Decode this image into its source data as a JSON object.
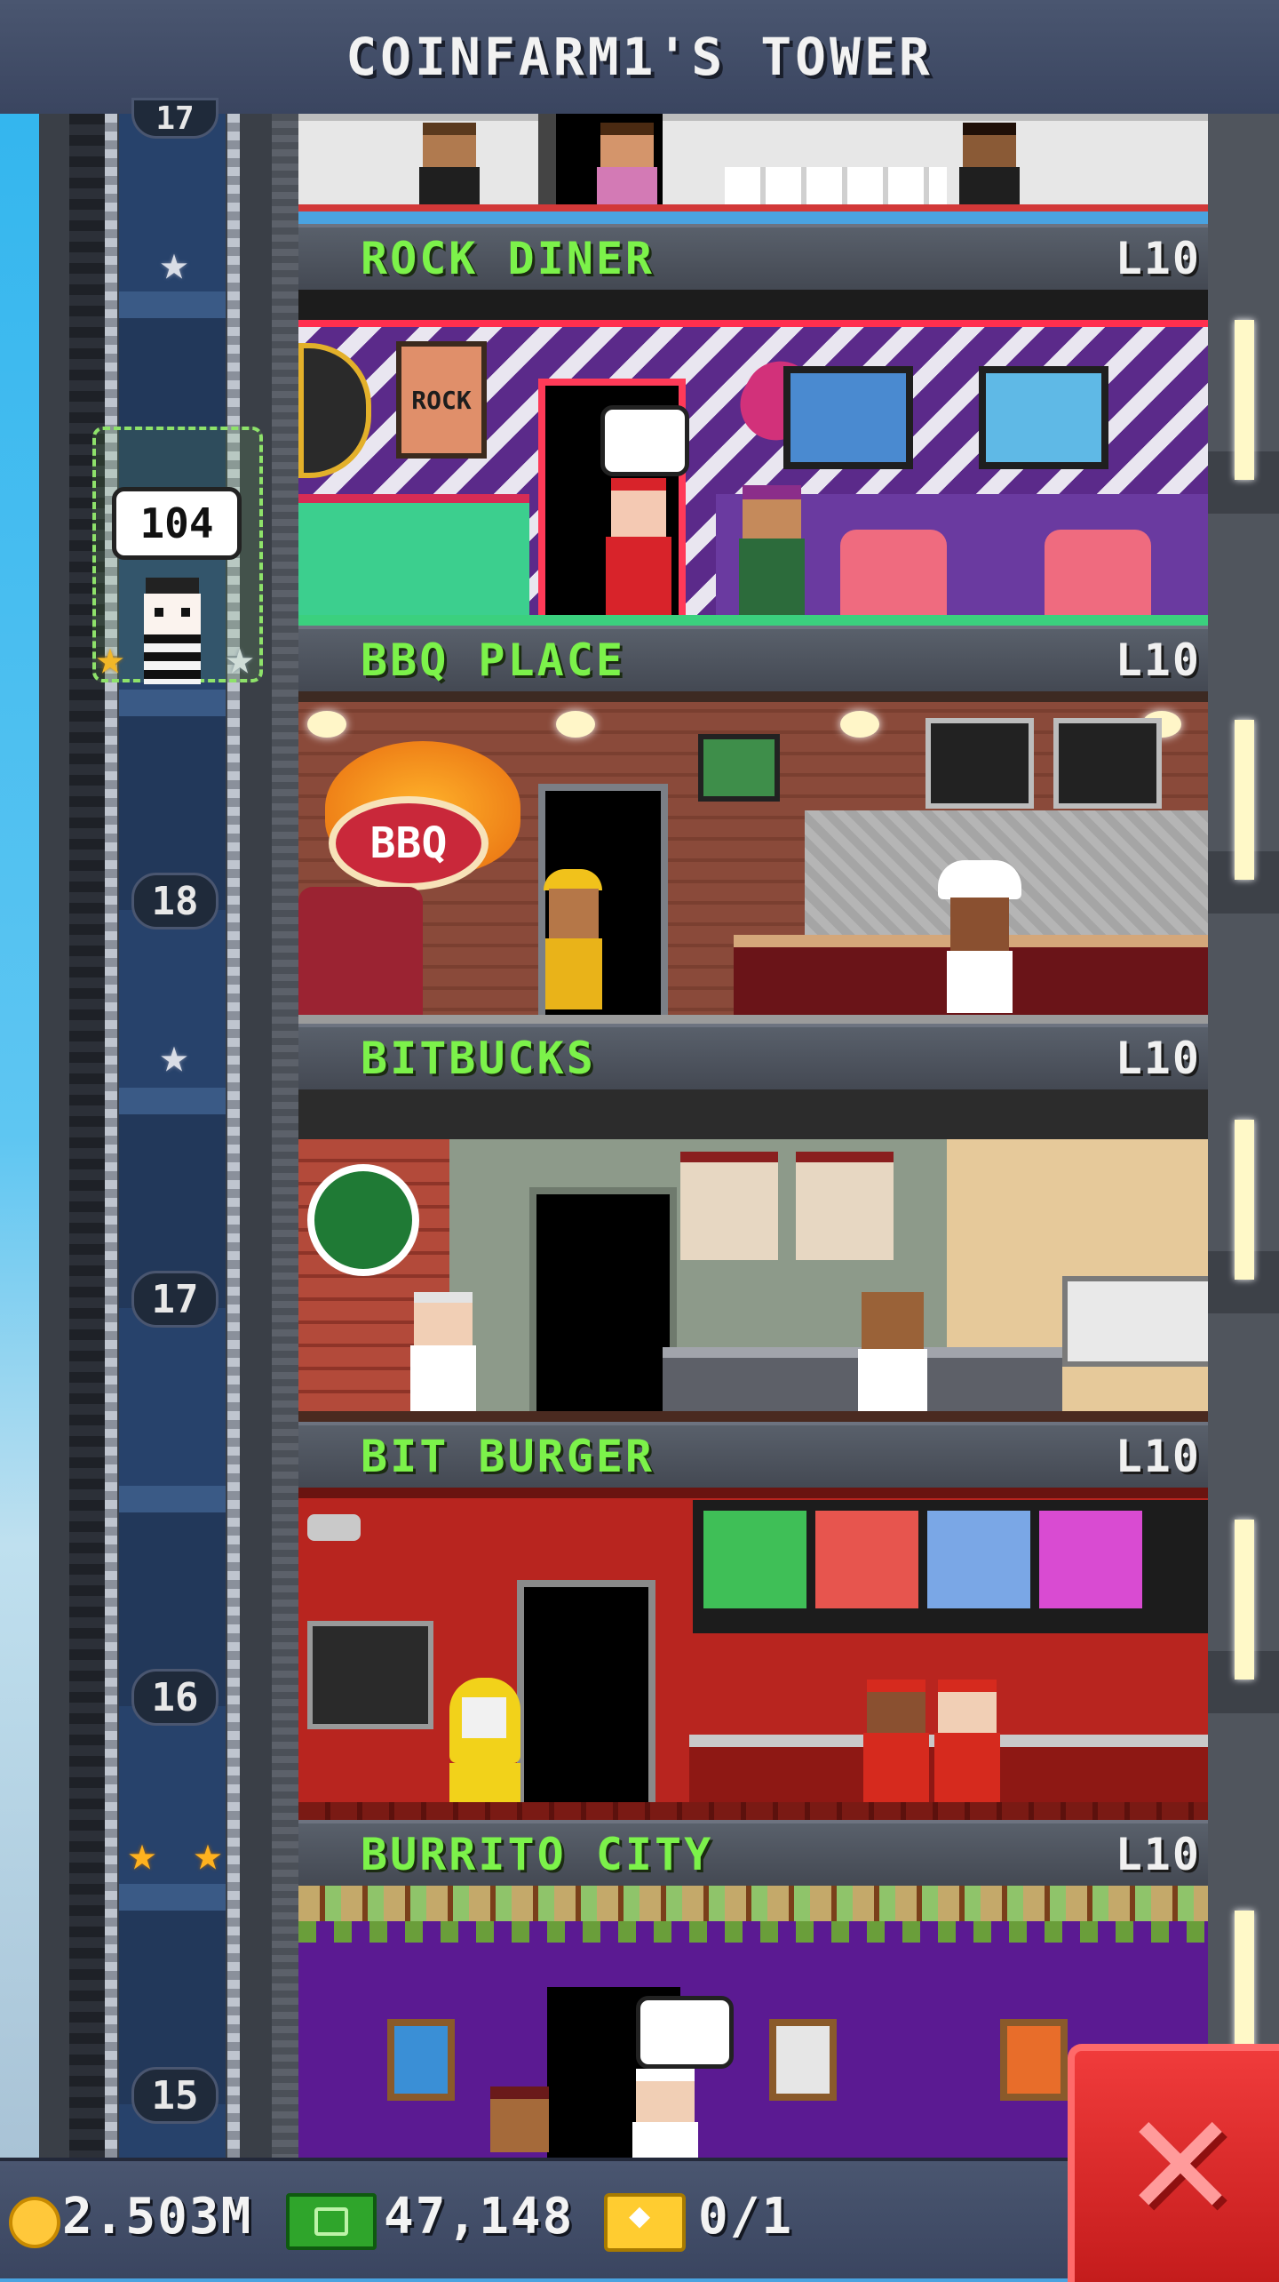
{
  "header": {
    "title": "COINFARM1'S TOWER"
  },
  "elevator": {
    "passenger_count": "104",
    "floor_labels": [
      "18",
      "17",
      "16",
      "15"
    ],
    "top_partial_label": "17"
  },
  "floors": [
    {
      "name": "ROCK DINER",
      "level": "L10"
    },
    {
      "name": "BBQ PLACE",
      "level": "L10"
    },
    {
      "name": "BITBUCKS",
      "level": "L10"
    },
    {
      "name": "BIT BURGER",
      "level": "L10"
    },
    {
      "name": "BURRITO CITY",
      "level": "L10"
    }
  ],
  "rooms": {
    "rock_diner": {
      "sign_text": "ROCK"
    },
    "bbq_place": {
      "sign_text": "BBQ"
    }
  },
  "resources": {
    "coins": "2.503M",
    "bux": "47,148",
    "tickets": "0/1"
  },
  "icons": {
    "coin": "coin-icon",
    "bux": "bux-icon",
    "ticket": "ticket-icon",
    "close": "close-icon"
  },
  "colors": {
    "floor_name": "#7cf24a",
    "header_bg": "#4a5670",
    "close_button": "#e02a2a"
  }
}
